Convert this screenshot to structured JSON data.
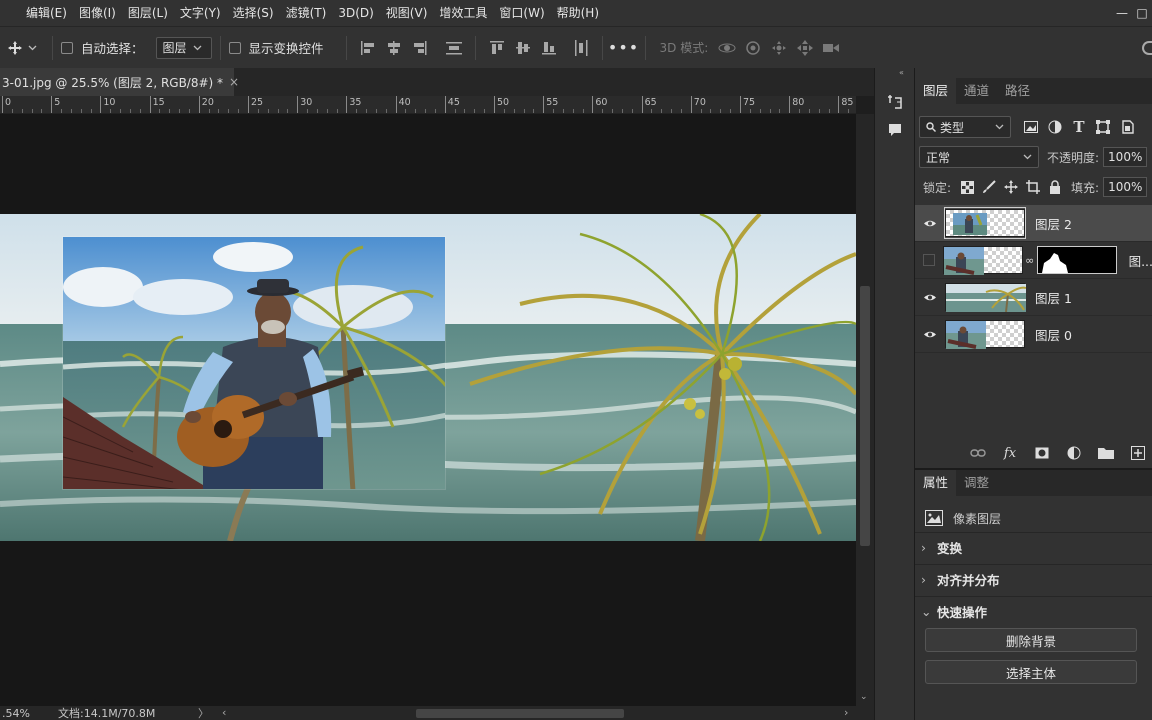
{
  "menubar": {
    "items": [
      "编辑(E)",
      "图像(I)",
      "图层(L)",
      "文字(Y)",
      "选择(S)",
      "滤镜(T)",
      "3D(D)",
      "视图(V)",
      "增效工具",
      "窗口(W)",
      "帮助(H)"
    ]
  },
  "options": {
    "auto_select_label": "自动选择：",
    "auto_select_target": "图层",
    "show_transform_label": "显示变换控件",
    "mode_3d_label": "3D 模式:"
  },
  "document": {
    "tab_title": "3-01.jpg @ 25.5% (图层 2, RGB/8#) *",
    "close_glyph": "×"
  },
  "ruler": {
    "labels": [
      "0",
      "5",
      "10",
      "15",
      "20",
      "25",
      "30",
      "35",
      "40",
      "45",
      "50",
      "55",
      "60",
      "65",
      "70",
      "75",
      "80",
      "85"
    ]
  },
  "status": {
    "zoom": ".54%",
    "doc_size": "文档:14.1M/70.8M",
    "arrow": "〉",
    "left_arrow": "‹",
    "right_arrow": "›"
  },
  "layers_panel": {
    "tabs": [
      "图层",
      "通道",
      "路径"
    ],
    "filter_kind": "类型",
    "blend_mode": "正常",
    "opacity_label": "不透明度:",
    "opacity_value": "100%",
    "lock_label": "锁定:",
    "fill_label": "填充:",
    "fill_value": "100%",
    "layers": [
      {
        "name": "图层 2",
        "visible": true,
        "selected": true,
        "has_mask": false
      },
      {
        "name": "图...",
        "visible": false,
        "selected": false,
        "has_mask": true
      },
      {
        "name": "图层 1",
        "visible": true,
        "selected": false,
        "has_mask": false
      },
      {
        "name": "图层 0",
        "visible": true,
        "selected": false,
        "has_mask": false
      }
    ]
  },
  "props_panel": {
    "tabs": [
      "属性",
      "调整"
    ],
    "kind": "像素图层",
    "sections": [
      "变换",
      "对齐并分布",
      "快速操作"
    ],
    "quick_actions": [
      "删除背景",
      "选择主体"
    ]
  },
  "colors": {
    "app_bg": "#323232",
    "canvas_bg": "#171717",
    "selected_layer": "#4b4b4b"
  }
}
